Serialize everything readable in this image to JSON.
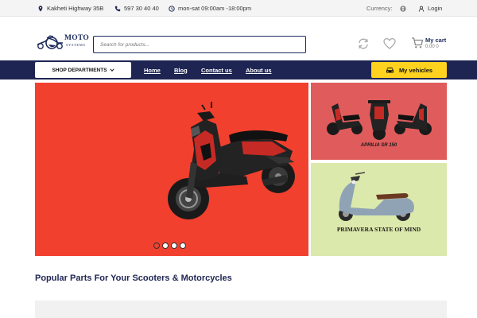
{
  "topbar": {
    "address": "Kakheti Highway 35B",
    "phone": "597 30 40 40",
    "hours": "mon-sat 09:00am -18:00pm",
    "currency_label": "Currency:",
    "login_label": "Login",
    "icons": [
      "map-pin-icon",
      "phone-icon",
      "clock-icon",
      "globe-icon",
      "user-icon"
    ]
  },
  "header": {
    "logo_text": "MOTO",
    "logo_subtext": "SYSTEMS",
    "search_placeholder": "Search for products...",
    "cart_label": "My cart",
    "cart_amount": "0.00 0",
    "icons": [
      "sync-icon",
      "heart-icon",
      "cart-icon"
    ]
  },
  "navbar": {
    "departments_label": "SHOP DEPARTMENTS",
    "links": [
      "Home",
      "Blog",
      "Contact us",
      "About us"
    ],
    "vehicles_label": "My vehicles"
  },
  "hero": {
    "slides": 4,
    "active_slide": 1
  },
  "banners": {
    "side1_caption": "APRILIA SR 150",
    "side2_caption": "PRIMAVERA STATE OF MIND"
  },
  "section": {
    "title": "Popular Parts For Your Scooters & Motorcycles"
  },
  "colors": {
    "navy": "#1e2552",
    "accent_yellow": "#ffd21f",
    "hero_red": "#f2402e",
    "banner_red": "#e05c5c",
    "banner_green": "#dbe9ac"
  }
}
